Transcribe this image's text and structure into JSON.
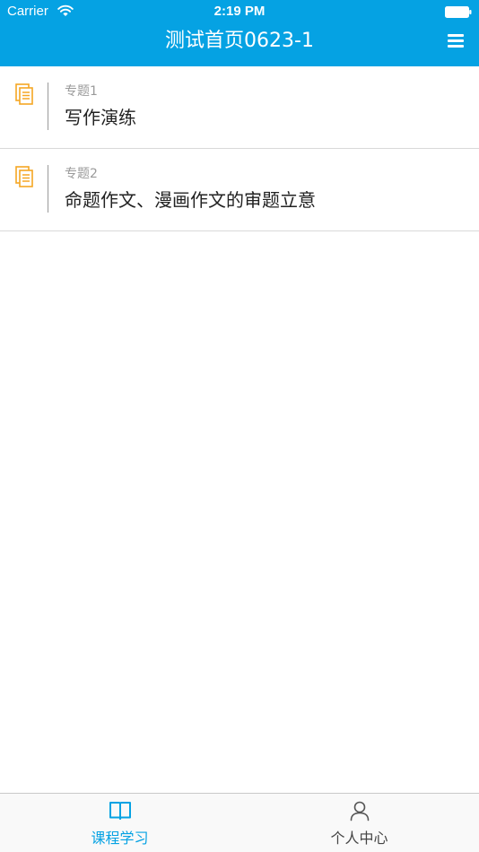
{
  "status_bar": {
    "carrier": "Carrier",
    "time": "2:19 PM"
  },
  "nav": {
    "title": "测试首页0623-1",
    "menu_icon": "hamburger-menu-icon"
  },
  "topics": [
    {
      "label": "专题1",
      "title": "写作演练",
      "icon": "document-icon"
    },
    {
      "label": "专题2",
      "title": "命题作文、漫画作文的审题立意",
      "icon": "document-icon"
    }
  ],
  "tab_bar": {
    "tabs": [
      {
        "label": "课程学习",
        "icon": "open-book-icon",
        "active": true
      },
      {
        "label": "个人中心",
        "icon": "person-icon",
        "active": false
      }
    ]
  },
  "colors": {
    "brand_blue": "#05a2e3",
    "topic_icon_orange": "#f5a623",
    "text_gray": "#9a9a9a",
    "text_dark": "#222222"
  }
}
